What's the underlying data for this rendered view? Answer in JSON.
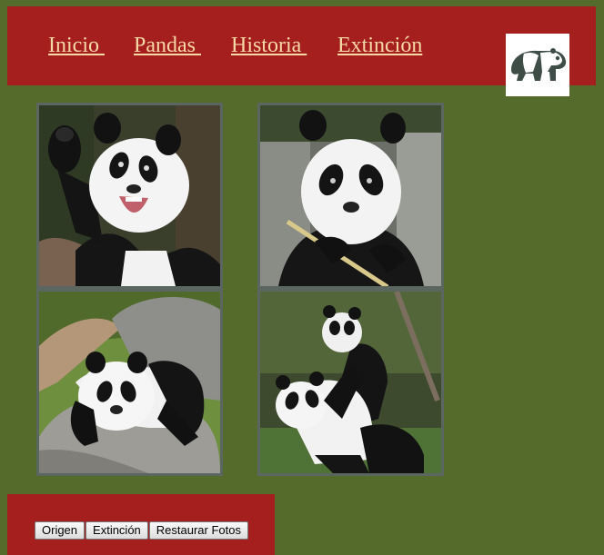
{
  "nav": {
    "items": [
      {
        "label": "Inicio "
      },
      {
        "label": "Pandas "
      },
      {
        "label": "Historia "
      },
      {
        "label": "Extinción"
      }
    ]
  },
  "logo": {
    "icon": "panda-logo-icon"
  },
  "gallery": {
    "photos": [
      {
        "subject": "panda-waving-icon"
      },
      {
        "subject": "panda-eating-bamboo-icon"
      },
      {
        "subject": "panda-resting-on-rock-icon"
      },
      {
        "subject": "panda-cubs-playing-icon"
      }
    ]
  },
  "footer": {
    "buttons": [
      {
        "label": "Origen"
      },
      {
        "label": "Extinción"
      },
      {
        "label": "Restaurar Fotos"
      }
    ]
  },
  "colors": {
    "page_background": "#556b2b",
    "header_background": "#a61f1f",
    "link_color": "#f6d9a6",
    "photo_border": "#5c6660"
  }
}
